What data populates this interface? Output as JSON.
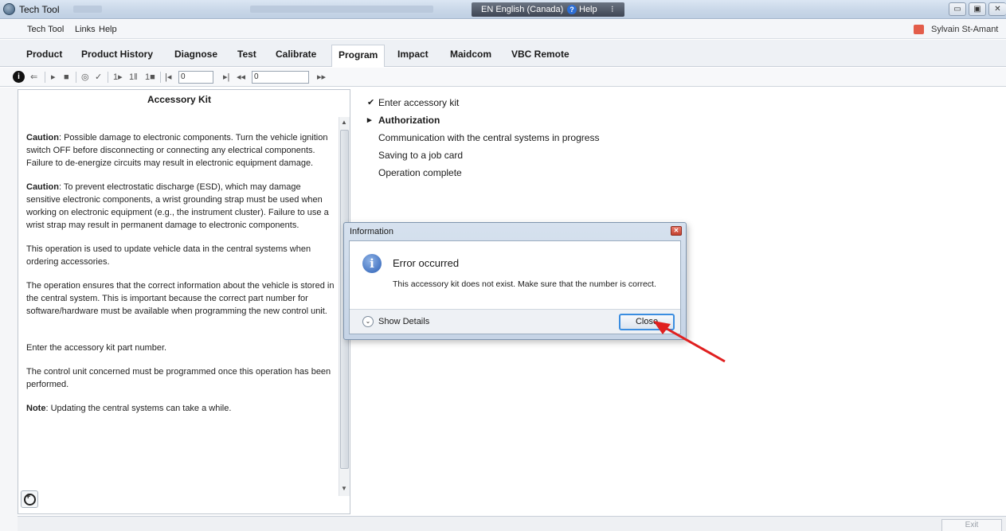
{
  "window": {
    "title": "Tech Tool",
    "language": "EN English (Canada)",
    "help_label": "Help"
  },
  "menubar": {
    "items": [
      "Tech Tool",
      "Links",
      "Help"
    ],
    "user": "Sylvain St-Amant"
  },
  "tabs": [
    "Product",
    "Product History",
    "Diagnose",
    "Test",
    "Calibrate",
    "Program",
    "Impact",
    "Maidcom",
    "VBC Remote"
  ],
  "active_tab": "Program",
  "toolbar": {
    "field1_value": "0",
    "field2_value": "0"
  },
  "left_panel": {
    "title": "Accessory Kit",
    "paragraphs": [
      {
        "lead": "Caution",
        "text": ": Possible damage to electronic components. Turn the vehicle ignition switch OFF before disconnecting or connecting any electrical components. Failure to de-energize circuits may result in electronic equipment damage."
      },
      {
        "lead": "Caution",
        "text": ": To prevent electrostatic discharge (ESD), which may damage sensitive electronic components, a wrist grounding strap must be used when working on electronic equipment (e.g., the instrument cluster). Failure to use a wrist strap may result in permanent damage to electronic components."
      },
      {
        "lead": "",
        "text": "This operation is used to update vehicle data in the central systems when ordering accessories."
      },
      {
        "lead": "",
        "text": "The operation ensures that the correct information about the vehicle is stored in the central system. This is important because the correct part number for software/hardware must be available when programming the new control unit."
      },
      {
        "lead": "",
        "text": "Enter the accessory kit part number."
      },
      {
        "lead": "",
        "text": "The control unit concerned must be programmed once this operation has been performed."
      },
      {
        "lead": "Note",
        "text": ": Updating the central systems can take a while."
      }
    ]
  },
  "steps": [
    {
      "mark": "✔",
      "label": "Enter accessory kit",
      "bold": false
    },
    {
      "mark": "▸",
      "label": "Authorization",
      "bold": true
    },
    {
      "mark": "",
      "label": "Communication with the central systems in progress",
      "bold": false
    },
    {
      "mark": "",
      "label": "Saving to a job card",
      "bold": false
    },
    {
      "mark": "",
      "label": "Operation complete",
      "bold": false
    }
  ],
  "dialog": {
    "title": "Information",
    "heading": "Error occurred",
    "message": "This accessory kit does not exist. Make sure that the number is correct.",
    "show_details": "Show Details",
    "close_label": "Close"
  },
  "statusbar": {
    "exit_label": "Exit"
  },
  "colors": {
    "arrow": "#e02020",
    "focus": "#3a8de0"
  }
}
